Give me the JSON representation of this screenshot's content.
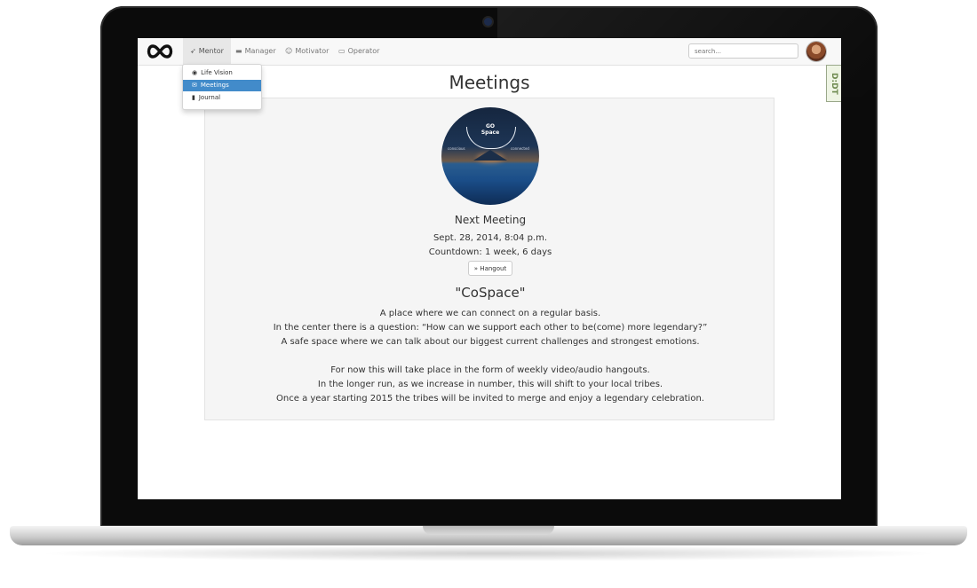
{
  "nav": {
    "items": [
      {
        "label": "Mentor",
        "icon": "rocket-icon"
      },
      {
        "label": "Manager",
        "icon": "briefcase-icon"
      },
      {
        "label": "Motivator",
        "icon": "smile-icon"
      },
      {
        "label": "Operator",
        "icon": "monitor-icon"
      }
    ],
    "search_placeholder": "search..."
  },
  "dropdown": {
    "items": [
      {
        "label": "Life Vision",
        "icon": "eye-icon"
      },
      {
        "label": "Meetings",
        "icon": "comments-icon"
      },
      {
        "label": "Journal",
        "icon": "book-icon"
      }
    ]
  },
  "badge": "D:DT",
  "page": {
    "title": "Meetings",
    "logo": {
      "line1": "GO",
      "line2": "Space",
      "left": "conscious",
      "right": "connected"
    },
    "next_label": "Next Meeting",
    "date": "Sept. 28, 2014, 8:04 p.m.",
    "countdown": "Countdown: 1 week, 6 days",
    "hangout": "» Hangout",
    "quote_title": "\"CoSpace\"",
    "description": [
      "A place where we can connect on a regular basis.",
      "In the center there is a question: “How can we support each other to be(come) more legendary?”",
      "A safe space where we can talk about our biggest current challenges and strongest emotions.",
      "For now this will take place in the form of weekly video/audio hangouts.",
      "In the longer run, as we increase in number, this will shift to your local tribes.",
      "Once a year starting 2015 the tribes will be invited to merge and enjoy a legendary celebration."
    ]
  },
  "colors": {
    "dropdown_active": "#428bca",
    "navbar_bg": "#f8f8f8",
    "card_bg": "#f5f5f5"
  }
}
